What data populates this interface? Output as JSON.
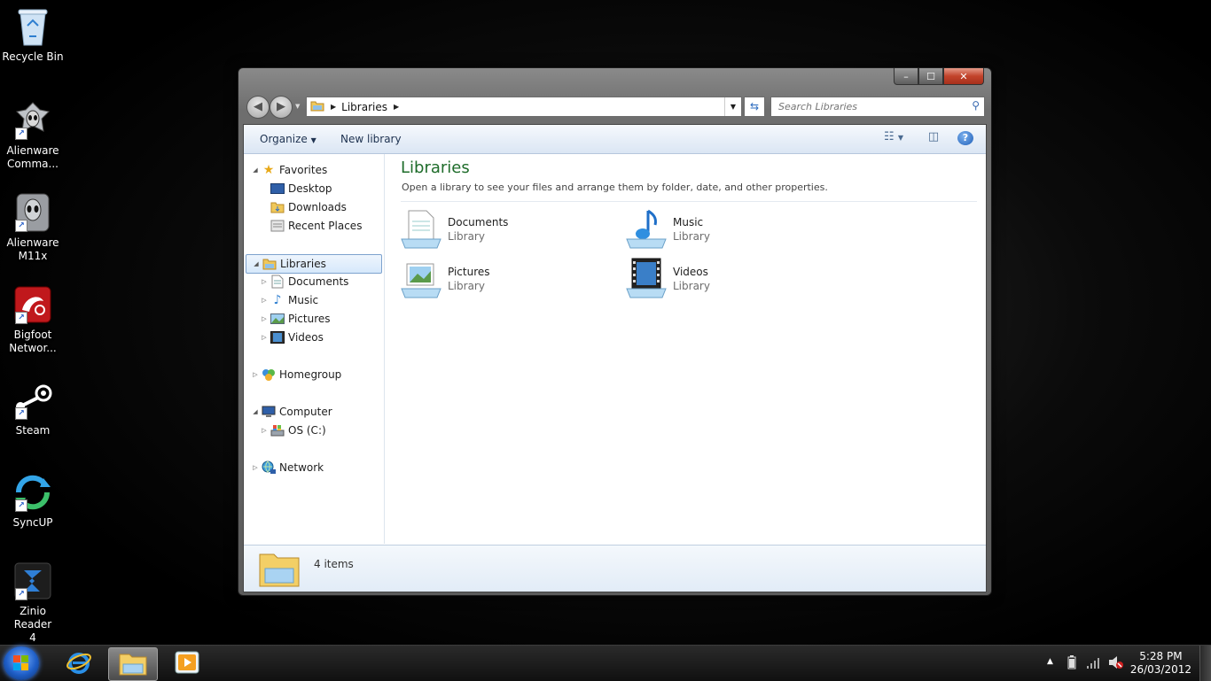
{
  "desktop": {
    "icons": [
      {
        "label": "Recycle Bin"
      },
      {
        "label": "Alienware\nComma..."
      },
      {
        "label": "Alienware\nM11x"
      },
      {
        "label": "Bigfoot\nNetwor..."
      },
      {
        "label": "Steam"
      },
      {
        "label": "SyncUP"
      },
      {
        "label": "Zinio Reader\n4"
      }
    ]
  },
  "window": {
    "caption": {
      "minimize": "–",
      "maximize": "☐",
      "close": "✕"
    },
    "address": {
      "crumb": "Libraries"
    },
    "search": {
      "placeholder": "Search Libraries"
    },
    "toolbar": {
      "organize": "Organize",
      "new_library": "New library",
      "help": "?"
    },
    "nav": {
      "favorites": "Favorites",
      "desktop": "Desktop",
      "downloads": "Downloads",
      "recent": "Recent Places",
      "libraries": "Libraries",
      "documents": "Documents",
      "music": "Music",
      "pictures": "Pictures",
      "videos": "Videos",
      "homegroup": "Homegroup",
      "computer": "Computer",
      "osc": "OS (C:)",
      "network": "Network"
    },
    "main": {
      "title": "Libraries",
      "subtitle": "Open a library to see your files and arrange them by folder, date, and other properties.",
      "libraries": [
        {
          "name": "Documents",
          "type": "Library"
        },
        {
          "name": "Music",
          "type": "Library"
        },
        {
          "name": "Pictures",
          "type": "Library"
        },
        {
          "name": "Videos",
          "type": "Library"
        }
      ]
    },
    "details": {
      "count": "4 items"
    }
  },
  "taskbar": {
    "time": "5:28 PM",
    "date": "26/03/2012"
  },
  "colors": {
    "title_green": "#1e6c2a",
    "selection_blue": "#d6e8fb"
  }
}
